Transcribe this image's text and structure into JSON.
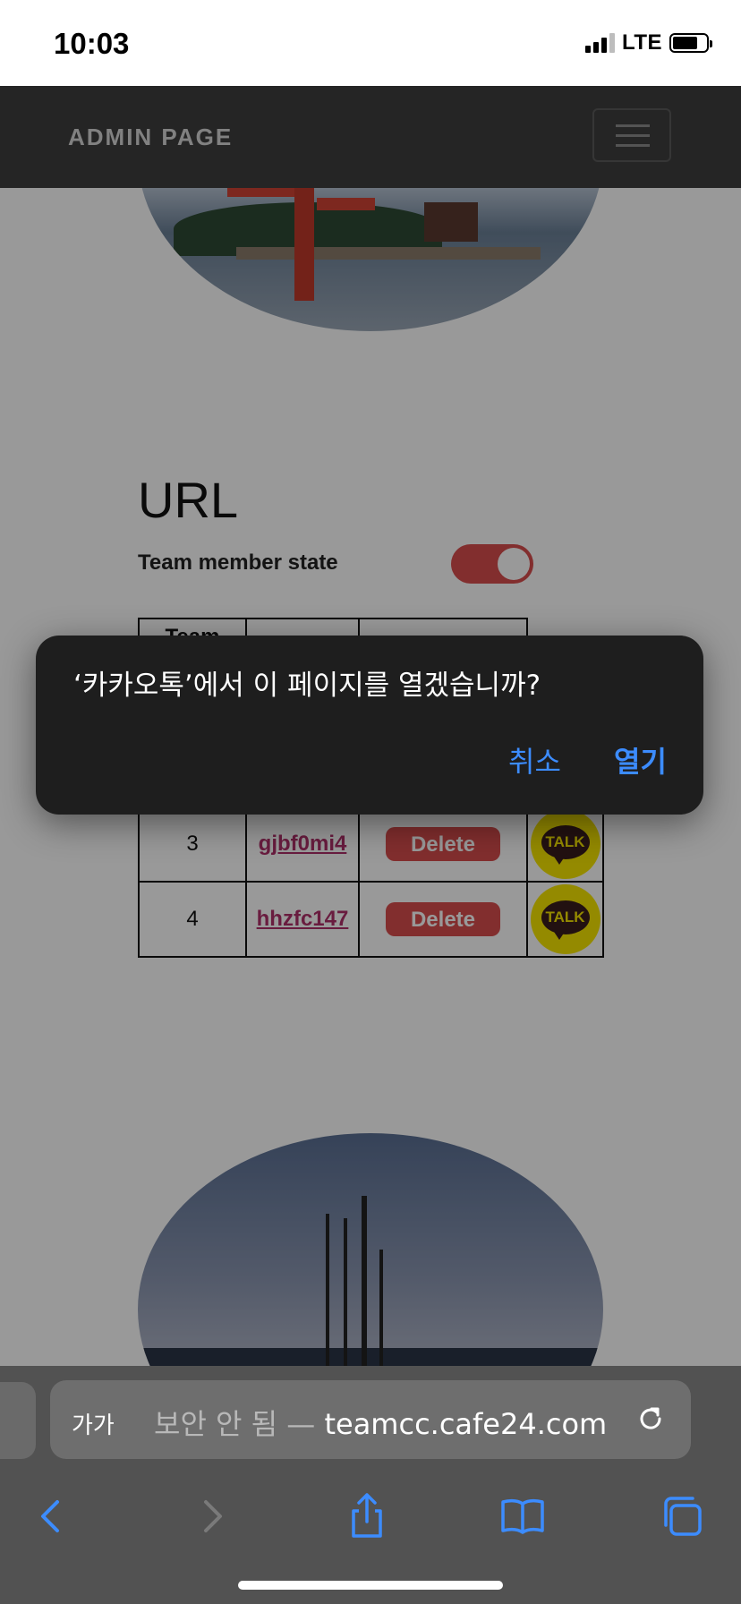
{
  "status_bar": {
    "time": "10:03",
    "network": "LTE",
    "signal_bars": 3,
    "battery_level": 0.75
  },
  "navbar": {
    "brand": "ADMIN PAGE"
  },
  "main": {
    "heading": "URL",
    "member_state_label": "Team member state",
    "member_state_on": true,
    "table": {
      "header": [
        "Team",
        "",
        "",
        ""
      ],
      "rows": [
        {
          "num": "3",
          "id": "gjbf0mi4",
          "action": "Delete",
          "badge": "TALK"
        },
        {
          "num": "4",
          "id": "hhzfc147",
          "action": "Delete",
          "badge": "TALK"
        }
      ]
    }
  },
  "alert": {
    "message": "‘카카오톡’에서 이 페이지를 열겠습니까?",
    "cancel": "취소",
    "open": "열기"
  },
  "browser": {
    "text_size_label": "가가",
    "insecure_label": "보안 안 됨 — ",
    "host": "teamcc.cafe24.com"
  },
  "colors": {
    "accent": "#d94d4d",
    "link": "#b0306a",
    "alert_button": "#3c8cff",
    "kakao_yellow": "#f7e600"
  }
}
